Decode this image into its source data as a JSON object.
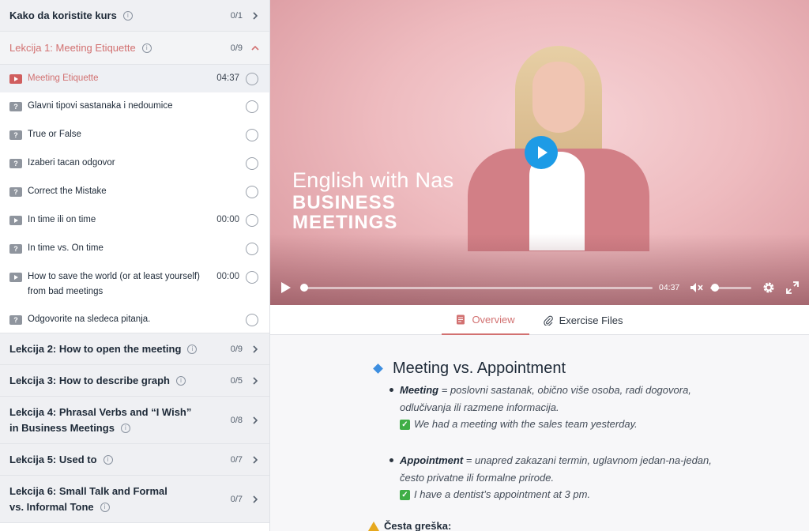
{
  "sidebar": {
    "top_section": {
      "title": "Kako da koristite kurs",
      "count": "0/1"
    },
    "active_section": {
      "title": "Lekcija 1: Meeting Etiquette",
      "count": "0/9",
      "lessons": [
        {
          "title": "Meeting Etiquette",
          "time": "04:37",
          "type": "video",
          "current": true
        },
        {
          "title": "Glavni tipovi sastanaka i nedoumice",
          "time": "",
          "type": "quiz"
        },
        {
          "title": "True or False",
          "time": "",
          "type": "quiz"
        },
        {
          "title": "Izaberi tacan odgovor",
          "time": "",
          "type": "quiz"
        },
        {
          "title": "Correct the Mistake",
          "time": "",
          "type": "quiz"
        },
        {
          "title": "In time ili on time",
          "time": "00:00",
          "type": "video"
        },
        {
          "title": "In time vs. On time",
          "time": "",
          "type": "quiz"
        },
        {
          "title": "How to save the world (or at least yourself) from bad meetings",
          "time": "00:00",
          "type": "video"
        },
        {
          "title": "Odgovorite na sledeca pitanja.",
          "time": "",
          "type": "quiz"
        }
      ]
    },
    "sections": [
      {
        "title": "Lekcija 2: How to open the meeting",
        "count": "0/9"
      },
      {
        "title": "Lekcija 3: How to describe graph",
        "count": "0/5"
      },
      {
        "title": "Lekcija 4: Phrasal Verbs and “I Wish” in Business Meetings",
        "count": "0/8"
      },
      {
        "title": "Lekcija 5: Used to",
        "count": "0/7"
      },
      {
        "title": "Lekcija 6: Small Talk and Formal vs. Informal Tone",
        "count": "0/7"
      }
    ]
  },
  "video": {
    "brand_line1": "English with Nas",
    "brand_line2": "BUSINESS",
    "brand_line3": "MEETINGS",
    "duration": "04:37",
    "progress": 0,
    "volume": 0.1,
    "muted": true
  },
  "tabs": [
    {
      "label": "Overview",
      "active": true,
      "icon": "document-icon"
    },
    {
      "label": "Exercise Files",
      "active": false,
      "icon": "paperclip-icon"
    }
  ],
  "content": {
    "heading": "Meeting vs. Appointment",
    "item1_term": "Meeting",
    "item1_def": " = poslovni sastanak, obično više osoba, radi dogovora, odlučivanja ili razmene informacija.",
    "item1_example": "We had a meeting with the sales team yesterday.",
    "item2_term": "Appointment",
    "item2_def": " = unapred zakazani termin, uglavnom jedan-na-jedan, često privatne ili formalne prirode.",
    "item2_example": "I have a dentist’s appointment at 3 pm.",
    "warning": "Česta greška:"
  },
  "colors": {
    "accent": "#d27171",
    "play_button": "#1d9be6",
    "check": "#3fae46"
  }
}
